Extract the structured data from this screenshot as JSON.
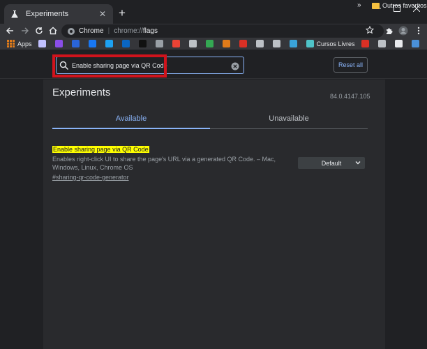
{
  "browser": {
    "tab": {
      "title": "Experiments"
    },
    "address": {
      "site_name": "Chrome",
      "url_scheme": "chrome://",
      "url_path": "flags"
    },
    "bookmarks": {
      "items": [
        {
          "label": "Apps",
          "icon": "apps-grid-icon",
          "color": "#e8eaed"
        },
        {
          "label": "",
          "icon": "flower-icon",
          "color": "#c0c0ff"
        },
        {
          "label": "",
          "icon": "purple-app-icon",
          "color": "#8a4ee8"
        },
        {
          "label": "",
          "icon": "blue-square-icon",
          "color": "#2a64d8"
        },
        {
          "label": "",
          "icon": "facebook-icon",
          "color": "#1877f2"
        },
        {
          "label": "",
          "icon": "twitter-icon",
          "color": "#1da1f2"
        },
        {
          "label": "",
          "icon": "linkedin-icon",
          "color": "#0a66c2"
        },
        {
          "label": "",
          "icon": "dark-app-icon",
          "color": "#111111"
        },
        {
          "label": "",
          "icon": "grid-icon",
          "color": "#9aa0a6"
        },
        {
          "label": "",
          "icon": "gmail-icon",
          "color": "#ea4335"
        },
        {
          "label": "",
          "icon": "doc-icon",
          "color": "#bdc1c6"
        },
        {
          "label": "",
          "icon": "chart-icon",
          "color": "#34a853"
        },
        {
          "label": "",
          "icon": "orange-circle-icon",
          "color": "#e07b1a"
        },
        {
          "label": "",
          "icon": "red-a-icon",
          "color": "#d93025"
        },
        {
          "label": "",
          "icon": "people-icon",
          "color": "#bdc1c6"
        },
        {
          "label": "",
          "icon": "hs-icon",
          "color": "#bdc1c6"
        },
        {
          "label": "",
          "icon": "iv-icon",
          "color": "#3aa3d8"
        },
        {
          "label": "Cursos Livres",
          "icon": "diamond-icon",
          "color": "#4fc3c8"
        },
        {
          "label": "",
          "icon": "red-stripes-icon",
          "color": "#d93025"
        },
        {
          "label": "",
          "icon": "paperclip-icon",
          "color": "#bdc1c6"
        },
        {
          "label": "",
          "icon": "globe-icon",
          "color": "#e8eaed"
        },
        {
          "label": "",
          "icon": "ring-icon",
          "color": "#4a90d9"
        }
      ],
      "more": "»",
      "folder": "Outros favoritos"
    }
  },
  "flags": {
    "search_value": "Enable sharing page via QR Code",
    "reset_label": "Reset all",
    "title": "Experiments",
    "version": "84.0.4147.105",
    "tabs": {
      "available": "Available",
      "unavailable": "Unavailable"
    },
    "experiment": {
      "name": "Enable sharing page via QR Code",
      "description": "Enables right-click UI to share the page's URL via a generated QR Code. – Mac, Windows, Linux, Chrome OS",
      "link": "#sharing-qr-code-generator",
      "selected": "Default"
    }
  },
  "colors": {
    "accent": "#8ab4f8",
    "highlight": "#ffff00",
    "annotation": "#d0131c"
  }
}
